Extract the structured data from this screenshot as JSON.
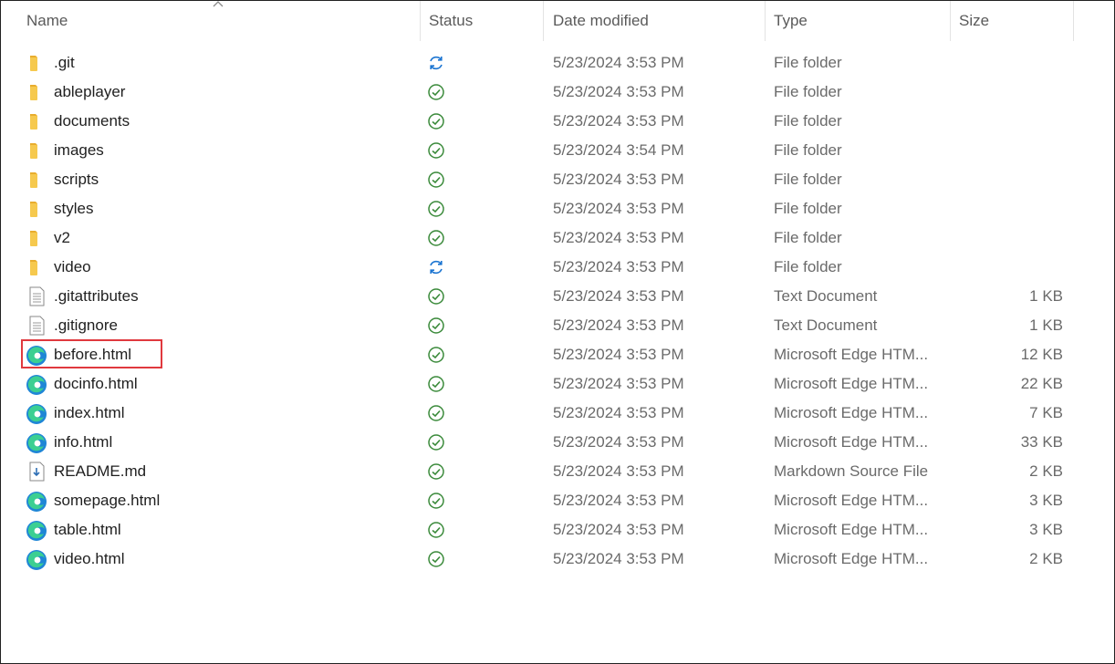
{
  "columns": {
    "name": "Name",
    "status": "Status",
    "date": "Date modified",
    "type": "Type",
    "size": "Size"
  },
  "colors": {
    "status_ok": "#3a8a3a",
    "status_sync": "#1b74d1",
    "folder": "#f4c24a",
    "highlight": "#e0393e"
  },
  "files": [
    {
      "name": ".git",
      "icon": "folder-icon",
      "status": "sync-icon",
      "date": "5/23/2024 3:53 PM",
      "type": "File folder",
      "size": ""
    },
    {
      "name": "ableplayer",
      "icon": "folder-icon",
      "status": "check-icon",
      "date": "5/23/2024 3:53 PM",
      "type": "File folder",
      "size": ""
    },
    {
      "name": "documents",
      "icon": "folder-icon",
      "status": "check-icon",
      "date": "5/23/2024 3:53 PM",
      "type": "File folder",
      "size": ""
    },
    {
      "name": "images",
      "icon": "folder-icon",
      "status": "check-icon",
      "date": "5/23/2024 3:54 PM",
      "type": "File folder",
      "size": ""
    },
    {
      "name": "scripts",
      "icon": "folder-icon",
      "status": "check-icon",
      "date": "5/23/2024 3:53 PM",
      "type": "File folder",
      "size": ""
    },
    {
      "name": "styles",
      "icon": "folder-icon",
      "status": "check-icon",
      "date": "5/23/2024 3:53 PM",
      "type": "File folder",
      "size": ""
    },
    {
      "name": "v2",
      "icon": "folder-icon",
      "status": "check-icon",
      "date": "5/23/2024 3:53 PM",
      "type": "File folder",
      "size": ""
    },
    {
      "name": "video",
      "icon": "folder-icon",
      "status": "sync-icon",
      "date": "5/23/2024 3:53 PM",
      "type": "File folder",
      "size": ""
    },
    {
      "name": ".gitattributes",
      "icon": "text-document-icon",
      "status": "check-icon",
      "date": "5/23/2024 3:53 PM",
      "type": "Text Document",
      "size": "1 KB"
    },
    {
      "name": ".gitignore",
      "icon": "text-document-icon",
      "status": "check-icon",
      "date": "5/23/2024 3:53 PM",
      "type": "Text Document",
      "size": "1 KB"
    },
    {
      "name": "before.html",
      "icon": "edge-icon",
      "status": "check-icon",
      "date": "5/23/2024 3:53 PM",
      "type": "Microsoft Edge HTM...",
      "size": "12 KB",
      "highlighted": true
    },
    {
      "name": "docinfo.html",
      "icon": "edge-icon",
      "status": "check-icon",
      "date": "5/23/2024 3:53 PM",
      "type": "Microsoft Edge HTM...",
      "size": "22 KB"
    },
    {
      "name": "index.html",
      "icon": "edge-icon",
      "status": "check-icon",
      "date": "5/23/2024 3:53 PM",
      "type": "Microsoft Edge HTM...",
      "size": "7 KB"
    },
    {
      "name": "info.html",
      "icon": "edge-icon",
      "status": "check-icon",
      "date": "5/23/2024 3:53 PM",
      "type": "Microsoft Edge HTM...",
      "size": "33 KB"
    },
    {
      "name": "README.md",
      "icon": "markdown-document-icon",
      "status": "check-icon",
      "date": "5/23/2024 3:53 PM",
      "type": "Markdown Source File",
      "size": "2 KB"
    },
    {
      "name": "somepage.html",
      "icon": "edge-icon",
      "status": "check-icon",
      "date": "5/23/2024 3:53 PM",
      "type": "Microsoft Edge HTM...",
      "size": "3 KB"
    },
    {
      "name": "table.html",
      "icon": "edge-icon",
      "status": "check-icon",
      "date": "5/23/2024 3:53 PM",
      "type": "Microsoft Edge HTM...",
      "size": "3 KB"
    },
    {
      "name": "video.html",
      "icon": "edge-icon",
      "status": "check-icon",
      "date": "5/23/2024 3:53 PM",
      "type": "Microsoft Edge HTM...",
      "size": "2 KB"
    }
  ]
}
